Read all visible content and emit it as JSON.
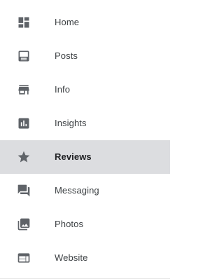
{
  "sidebar": {
    "items": [
      {
        "label": "Home",
        "icon": "dashboard-icon",
        "active": false
      },
      {
        "label": "Posts",
        "icon": "posts-icon",
        "active": false
      },
      {
        "label": "Info",
        "icon": "storefront-icon",
        "active": false
      },
      {
        "label": "Insights",
        "icon": "bar-chart-icon",
        "active": false
      },
      {
        "label": "Reviews",
        "icon": "star-icon",
        "active": true
      },
      {
        "label": "Messaging",
        "icon": "chat-icon",
        "active": false
      },
      {
        "label": "Photos",
        "icon": "photo-library-icon",
        "active": false
      },
      {
        "label": "Website",
        "icon": "web-icon",
        "active": false
      }
    ]
  },
  "colors": {
    "active_background": "#dcdde0",
    "icon": "#5f6368",
    "text": "#3c4043"
  }
}
